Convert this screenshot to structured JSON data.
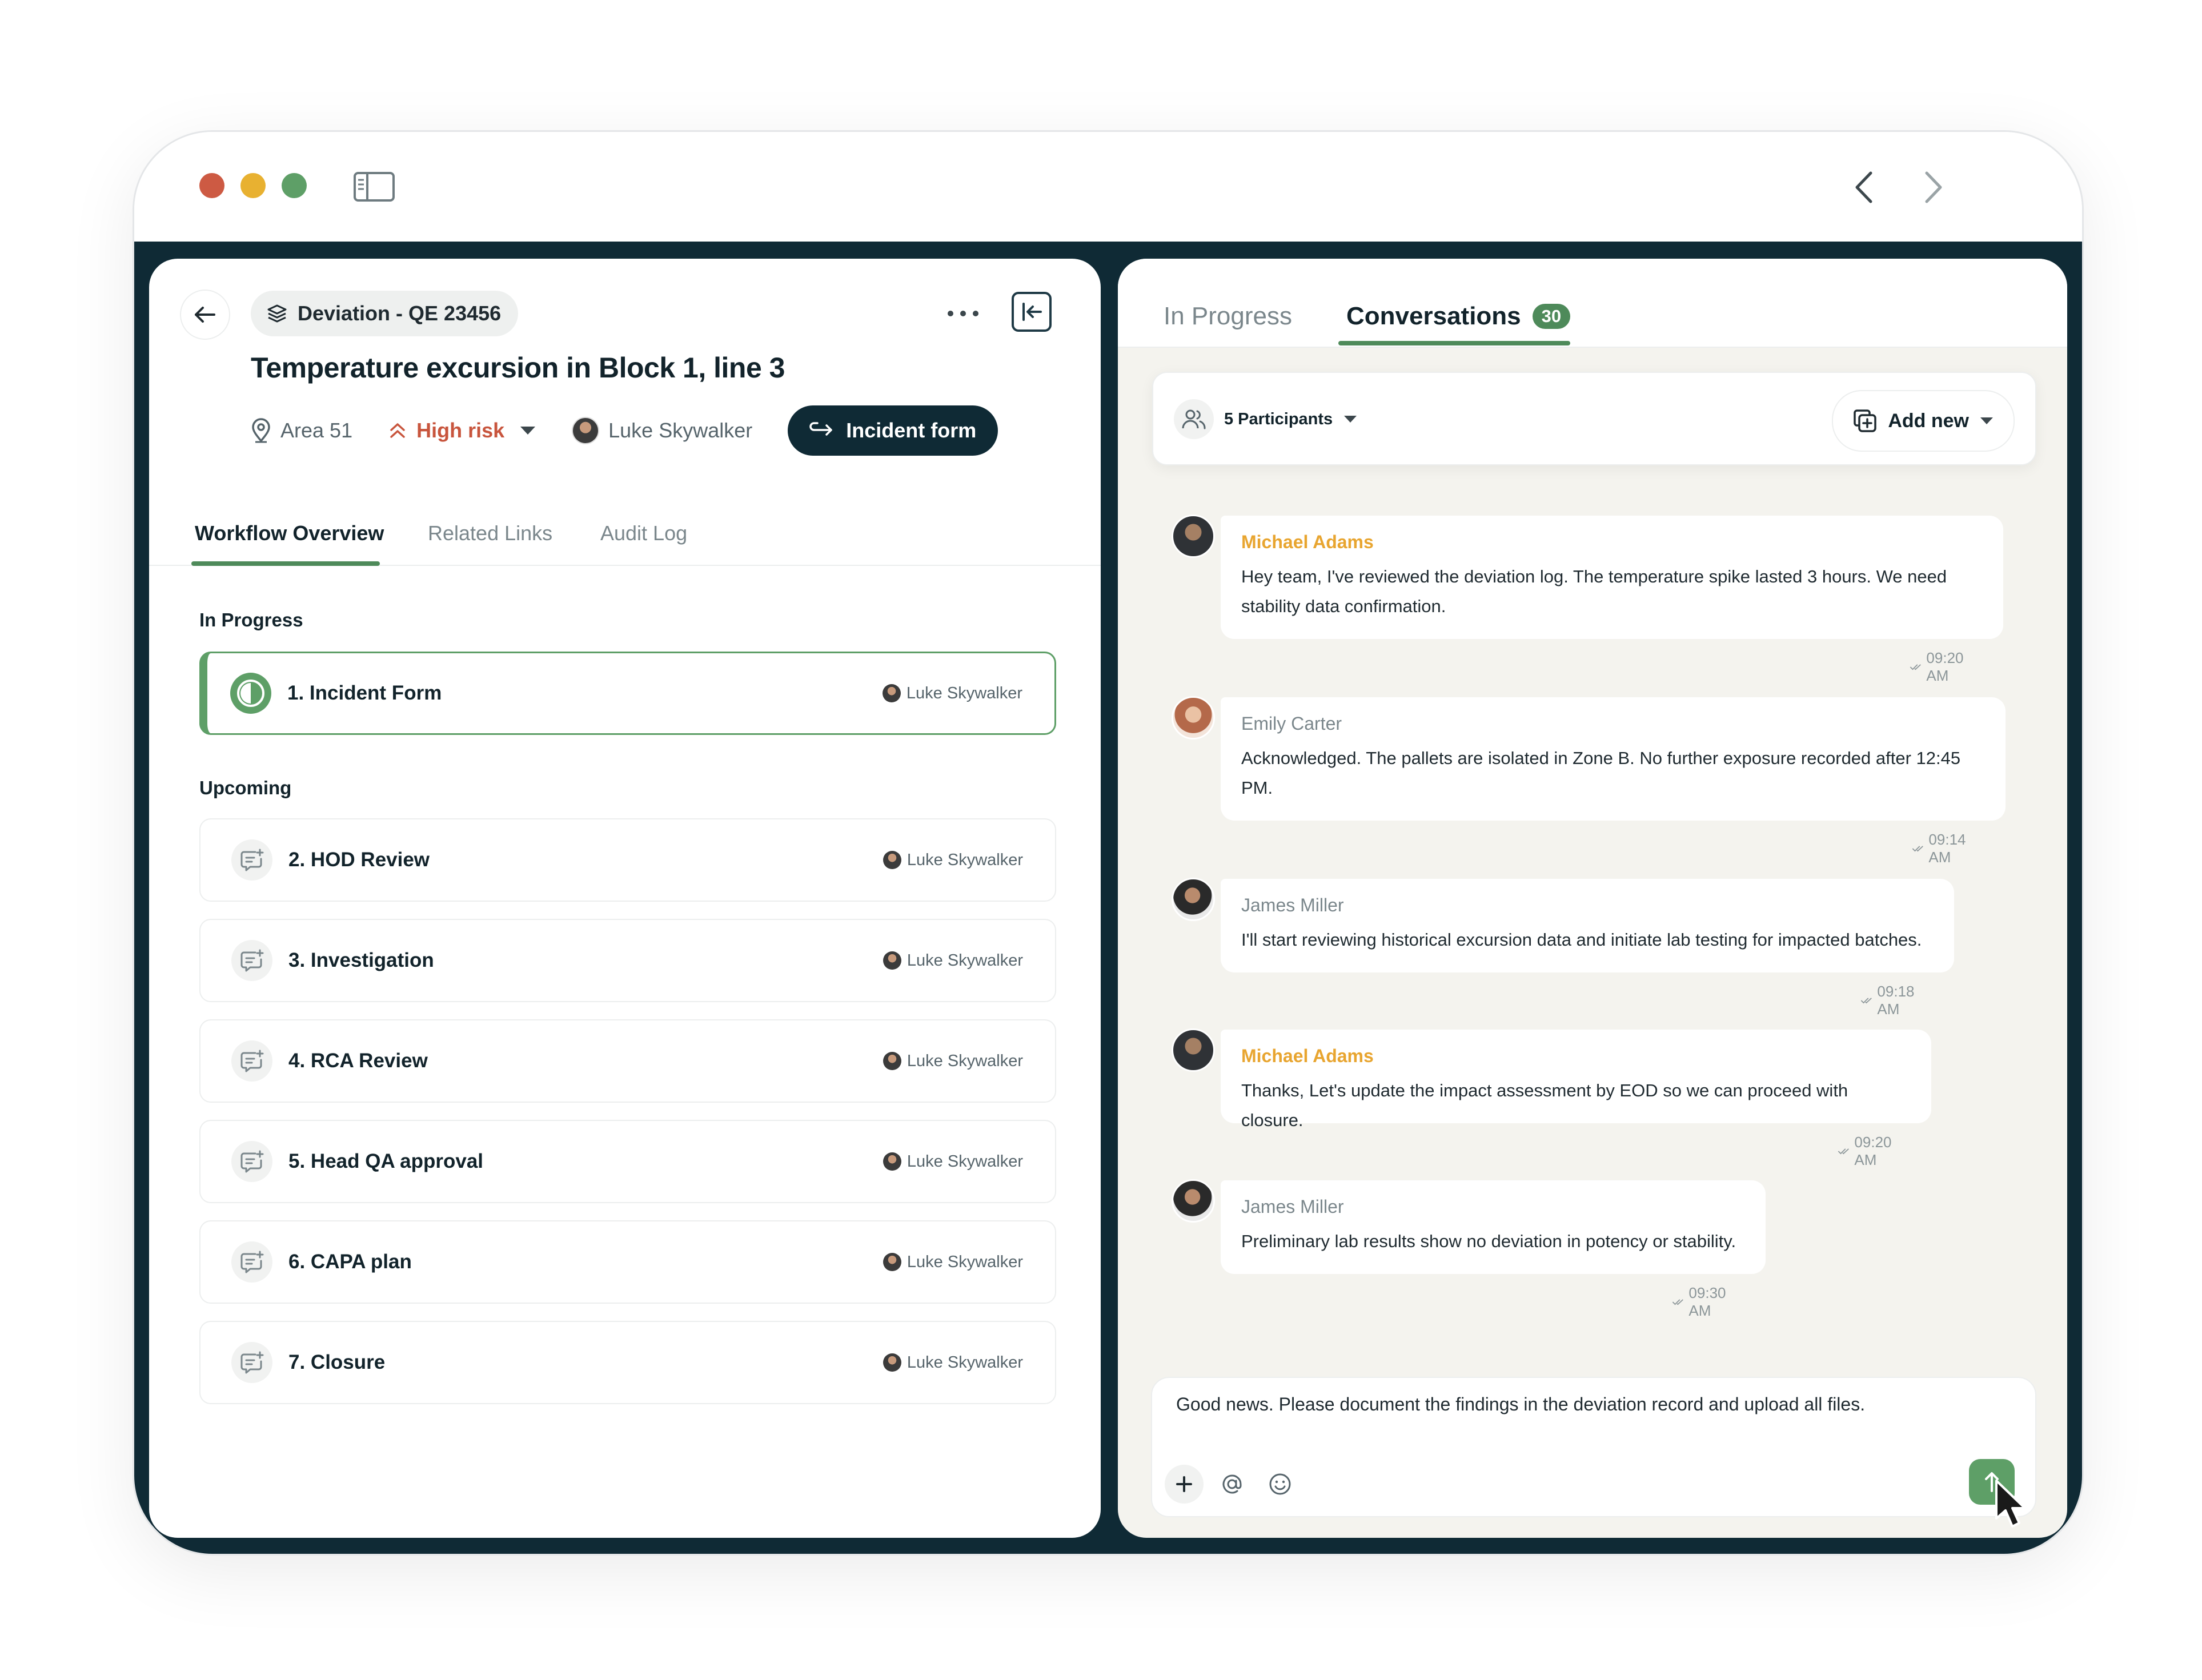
{
  "window": {
    "nav_back_icon": "chevron-left-icon",
    "nav_forward_icon": "chevron-right-icon"
  },
  "left": {
    "doc_chip": "Deviation - QE 23456",
    "title": "Temperature excursion in Block 1, line 3",
    "meta": {
      "location": "Area 51",
      "risk": "High risk",
      "owner": "Luke Skywalker",
      "incident_button": "Incident form"
    },
    "tabs": [
      "Workflow Overview",
      "Related Links",
      "Audit Log"
    ],
    "in_progress_label": "In Progress",
    "upcoming_label": "Upcoming",
    "active_step": {
      "title": "1. Incident Form",
      "owner": "Luke Skywalker"
    },
    "upcoming_steps": [
      {
        "title": "2. HOD Review",
        "owner": "Luke Skywalker"
      },
      {
        "title": "3. Investigation",
        "owner": "Luke Skywalker"
      },
      {
        "title": "4. RCA Review",
        "owner": "Luke Skywalker"
      },
      {
        "title": "5. Head QA approval",
        "owner": "Luke Skywalker"
      },
      {
        "title": "6. CAPA plan",
        "owner": "Luke Skywalker"
      },
      {
        "title": "7. Closure",
        "owner": "Luke Skywalker"
      }
    ]
  },
  "right": {
    "tab_in_progress": "In Progress",
    "tab_conversations": "Conversations",
    "conversations_count": "30",
    "participants": "5 Participants",
    "add_new": "Add new",
    "messages": [
      {
        "sender": "Michael Adams",
        "text": "Hey team, I've reviewed the deviation log. The temperature spike lasted 3 hours. We need stability data confirmation.",
        "time": "09:20 AM"
      },
      {
        "sender": "Emily Carter",
        "text": "Acknowledged. The pallets are isolated in Zone B. No further exposure recorded after 12:45 PM.",
        "time": "09:14 AM"
      },
      {
        "sender": "James Miller",
        "text": "I'll start reviewing historical excursion data and initiate lab testing for impacted batches.",
        "time": "09:18 AM"
      },
      {
        "sender": "Michael Adams",
        "text": "Thanks, Let's update the impact assessment by EOD so we can proceed with closure.",
        "time": "09:20 AM"
      },
      {
        "sender": "James Miller",
        "text": "Preliminary lab results show no deviation in potency or stability.",
        "time": "09:30 AM"
      }
    ],
    "composer_text": "Good news. Please document the findings in the deviation record and upload all files."
  },
  "colors": {
    "brand_dark": "#0f2a35",
    "accent_green": "#5e9f67",
    "risk_red": "#c8553d",
    "sender_orange": "#e8a530"
  }
}
